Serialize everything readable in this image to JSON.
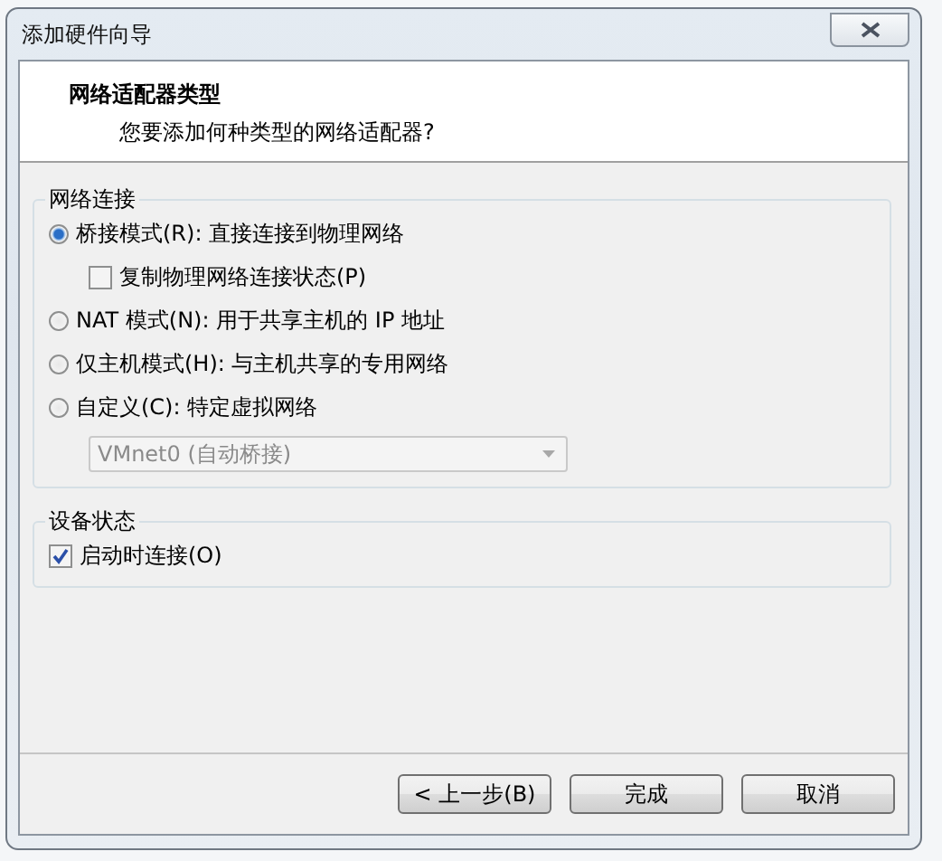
{
  "window": {
    "title": "添加硬件向导"
  },
  "header": {
    "title": "网络适配器类型",
    "subtitle": "您要添加何种类型的网络适配器?"
  },
  "network_group": {
    "legend": "网络连接",
    "options": [
      {
        "kind": "radio",
        "label": "桥接模式(R): 直接连接到物理网络",
        "selected": true
      },
      {
        "kind": "checkbox",
        "label": "复制物理网络连接状态(P)",
        "checked": false
      },
      {
        "kind": "radio",
        "label": "NAT 模式(N): 用于共享主机的 IP 地址",
        "selected": false
      },
      {
        "kind": "radio",
        "label": "仅主机模式(H): 与主机共享的专用网络",
        "selected": false
      },
      {
        "kind": "radio",
        "label": "自定义(C): 特定虚拟网络",
        "selected": false
      },
      {
        "kind": "select",
        "value": "VMnet0 (自动桥接)",
        "disabled": true
      }
    ]
  },
  "device_group": {
    "legend": "设备状态",
    "options": [
      {
        "kind": "checkbox",
        "label": "启动时连接(O)",
        "checked": true
      }
    ]
  },
  "buttons": [
    {
      "label": "< 上一步(B)"
    },
    {
      "label": "完成"
    },
    {
      "label": "取消"
    }
  ]
}
